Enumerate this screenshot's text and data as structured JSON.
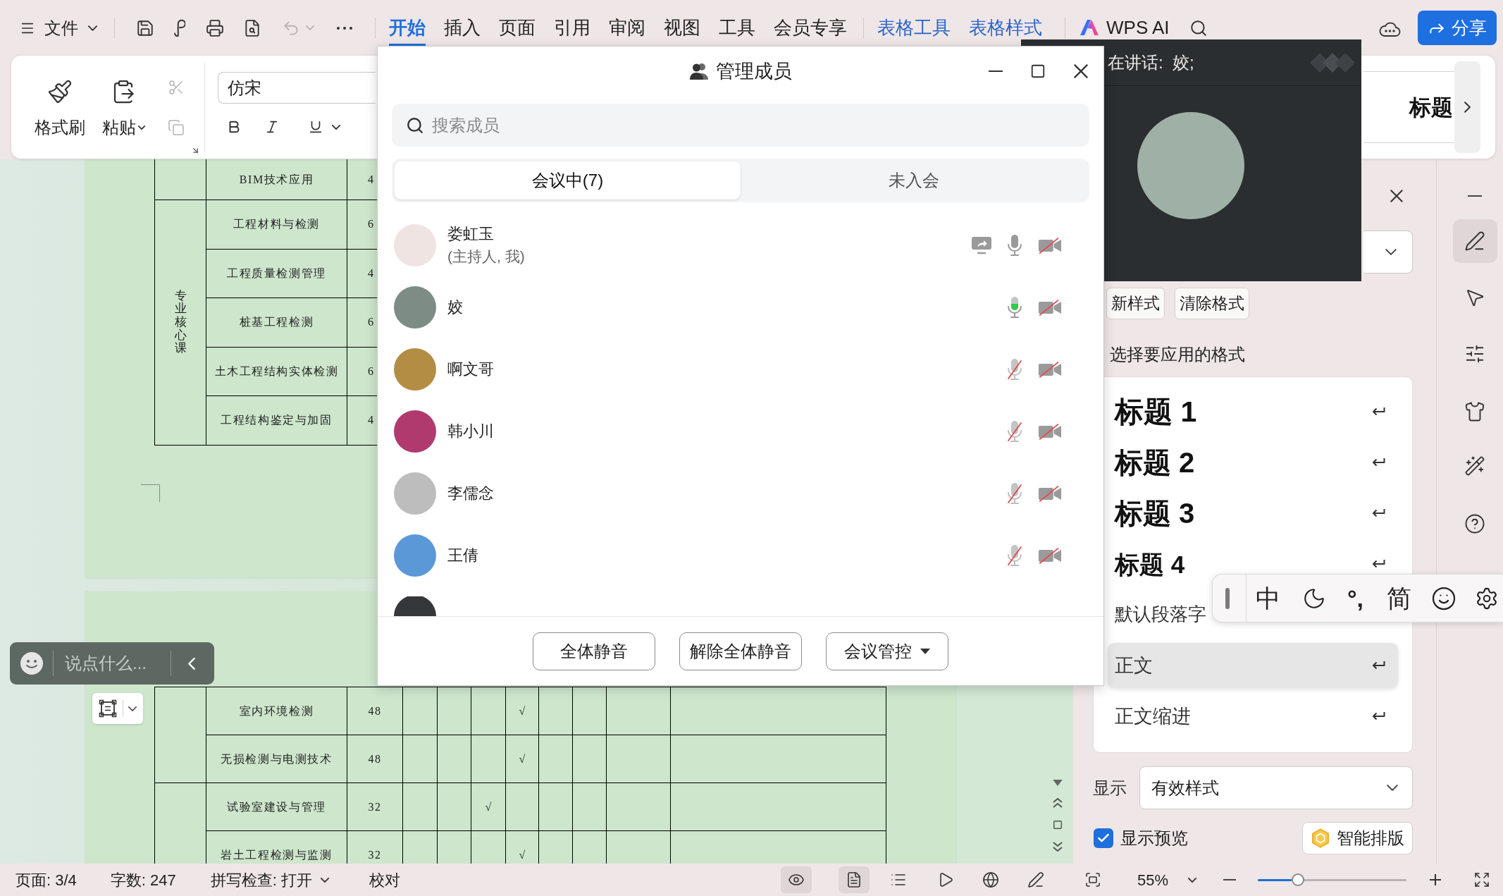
{
  "menu_bar": {
    "file_menu": "文件",
    "tabs": [
      {
        "label": "开始",
        "selected": true,
        "kind": "main"
      },
      {
        "label": "插入",
        "selected": false,
        "kind": "main"
      },
      {
        "label": "页面",
        "selected": false,
        "kind": "main"
      },
      {
        "label": "引用",
        "selected": false,
        "kind": "main"
      },
      {
        "label": "审阅",
        "selected": false,
        "kind": "main"
      },
      {
        "label": "视图",
        "selected": false,
        "kind": "main"
      },
      {
        "label": "工具",
        "selected": false,
        "kind": "main"
      },
      {
        "label": "会员专享",
        "selected": false,
        "kind": "main"
      },
      {
        "label": "表格工具",
        "selected": false,
        "kind": "context"
      },
      {
        "label": "表格样式",
        "selected": false,
        "kind": "context"
      }
    ],
    "ai_button": "WPS AI",
    "share_button": "分享"
  },
  "ribbon": {
    "format_painter": "格式刷",
    "paste": "粘贴",
    "font_name": "仿宋",
    "style_gallery_item": "标题"
  },
  "document": {
    "upper_table": {
      "groups": [
        {
          "rows": [
            {
              "course": "BIM技术应用",
              "hours": "4"
            }
          ]
        },
        {
          "category": "专业核心课",
          "rows": [
            {
              "course": "工程材料与检测",
              "hours": "6"
            },
            {
              "course": "工程质量检测管理",
              "hours": "4"
            },
            {
              "course": "桩基工程检测",
              "hours": "6"
            },
            {
              "course": "土木工程结构实体检测",
              "hours": "6"
            },
            {
              "course": "工程结构鉴定与加固",
              "hours": "4"
            }
          ]
        }
      ]
    },
    "lower_table": {
      "groups": [
        {
          "rows": [
            {
              "course": "室内环境检测",
              "hours": "48",
              "tick": "√",
              "tick_cells": [
                false,
                false,
                false,
                true,
                false,
                false,
                false,
                false
              ]
            },
            {
              "course": "无损检测与电测技术",
              "hours": "48",
              "tick": "√",
              "tick_cells": [
                false,
                false,
                false,
                true,
                false,
                false,
                false,
                false
              ]
            }
          ]
        },
        {
          "rows": [
            {
              "course": "试验室建设与管理",
              "hours": "32",
              "tick": "√",
              "tick_cells": [
                false,
                false,
                true,
                false,
                false,
                false,
                false,
                false
              ]
            },
            {
              "course": "岩土工程检测与监测",
              "hours": "32",
              "tick": "√",
              "tick_cells": [
                false,
                false,
                false,
                true,
                false,
                false,
                false,
                false
              ]
            }
          ]
        }
      ]
    }
  },
  "chat_bar": {
    "placeholder": "说点什么..."
  },
  "members_dialog": {
    "title": "管理成员",
    "search": {
      "placeholder": "搜索成员"
    },
    "tabs": [
      {
        "label": "会议中(7)",
        "selected": true
      },
      {
        "label": "未入会",
        "selected": false
      }
    ],
    "members": [
      {
        "kind": "full",
        "name": "娄虹玉",
        "role": "(主持人, 我)",
        "color": "#efe4e1",
        "screen_sharing": true,
        "mic_muted": false,
        "speaking": false,
        "camera_on": false
      },
      {
        "kind": "full",
        "name": "姣",
        "color": "#7d8c84",
        "screen_sharing": false,
        "mic_muted": false,
        "speaking": true,
        "camera_on": false
      },
      {
        "kind": "full",
        "name": "啊文哥",
        "color": "#b48d45",
        "screen_sharing": false,
        "mic_muted": true,
        "speaking": false,
        "camera_on": false
      },
      {
        "kind": "full",
        "name": "韩小川",
        "color": "#b03a6e",
        "screen_sharing": false,
        "mic_muted": true,
        "speaking": false,
        "camera_on": false
      },
      {
        "kind": "full",
        "name": "李儒念",
        "color": "#bdbdbd",
        "screen_sharing": false,
        "mic_muted": true,
        "speaking": false,
        "camera_on": false
      },
      {
        "kind": "full",
        "name": "王倩",
        "color": "#5b98d8",
        "screen_sharing": false,
        "mic_muted": true,
        "speaking": false,
        "camera_on": false
      },
      {
        "kind": "partial",
        "color": "#35373a"
      }
    ],
    "buttons": [
      {
        "label": "全体静音",
        "kind": "plain"
      },
      {
        "label": "解除全体静音",
        "kind": "plain"
      },
      {
        "label": "会议管控",
        "kind": "menu"
      }
    ]
  },
  "video_window": {
    "speaker_label": "在讲话:  姣;"
  },
  "styles_pane": {
    "buttons": [
      {
        "label": "新样式"
      },
      {
        "label": "清除格式"
      }
    ],
    "prompt": "选择要应用的格式",
    "styles": [
      {
        "label": "标题 1",
        "kind": "heading1",
        "selected": false
      },
      {
        "label": "标题 2",
        "kind": "heading2",
        "selected": false
      },
      {
        "label": "标题 3",
        "kind": "heading3",
        "selected": false
      },
      {
        "label": "标题 4",
        "kind": "heading4",
        "selected": false
      },
      {
        "label": "默认段落字",
        "kind": "character",
        "selected": false
      },
      {
        "label": "正文",
        "kind": "paragraph",
        "selected": true
      },
      {
        "label": "正文缩进",
        "kind": "paragraph",
        "selected": false
      }
    ],
    "display": {
      "label": "显示",
      "value": "有效样式"
    },
    "show_preview": {
      "label": "显示预览",
      "checked": true
    },
    "smart_layout_button": "智能排版"
  },
  "ime_bar": {
    "mode": "中",
    "punctuation": "°,",
    "script": "简"
  },
  "sidebar": {
    "tools": [
      {
        "selected": true
      },
      {
        "selected": false
      },
      {
        "selected": false
      },
      {
        "selected": false
      },
      {
        "selected": false
      },
      {
        "selected": false
      }
    ]
  },
  "status_bar": {
    "page": "页面: 3/4",
    "word_count": "字数: 247",
    "spell_check": "拼写检查: 打开",
    "proofread": "校对",
    "view_modes": [
      {
        "selected": true
      },
      {
        "selected": true
      },
      {
        "selected": false
      },
      {
        "selected": false
      },
      {
        "selected": false
      },
      {
        "selected": false
      }
    ],
    "zoom": "55%",
    "zoom_slider": {
      "level": 0.27
    }
  }
}
